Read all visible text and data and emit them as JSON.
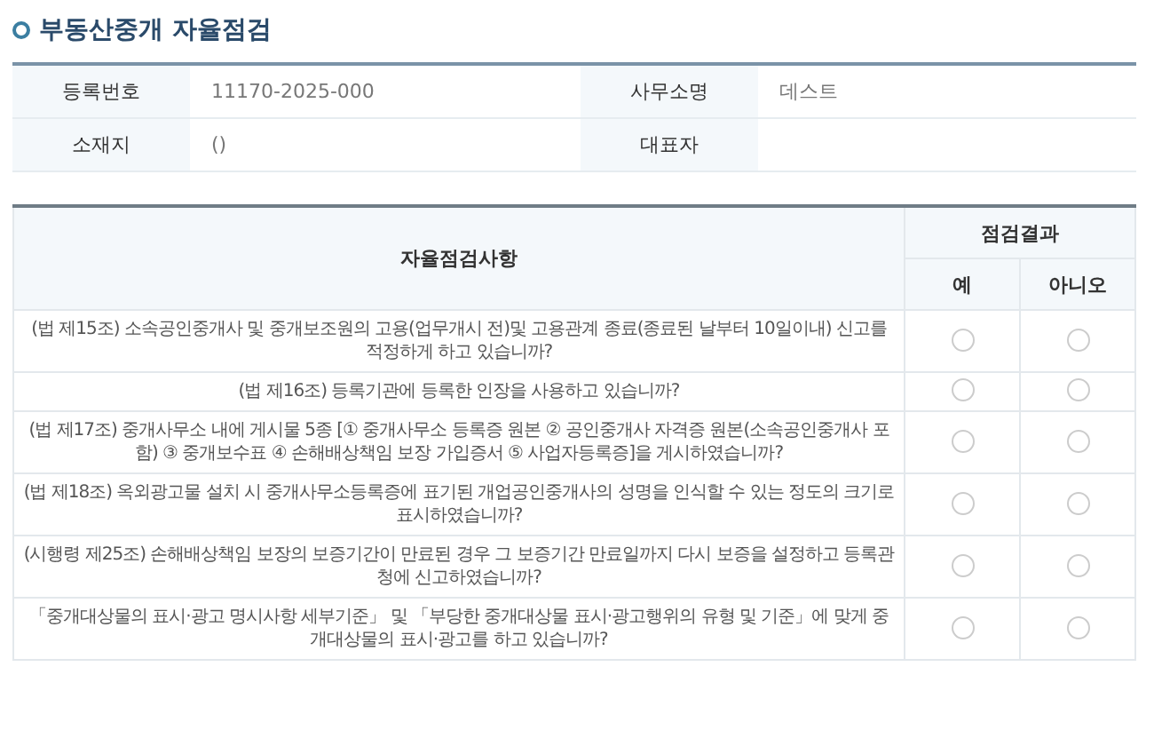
{
  "title": "부동산중개 자율점검",
  "info": [
    {
      "label": "등록번호",
      "value": "11170-2025-000"
    },
    {
      "label": "사무소명",
      "value": "데스트"
    },
    {
      "label": "소재지",
      "value": "()"
    },
    {
      "label": "대표자"
    }
  ],
  "checklist": {
    "item_header": "자율점검사항",
    "result_header": "점검결과",
    "options": [
      "예",
      "아니오"
    ],
    "rows": [
      {
        "text": "(법 제15조) 소속공인중개사 및 중개보조원의 고용(업무개시 전)및 고용관계 종료(종료된 날부터 10일이내) 신고를 적정하게 하고 있습니까?",
        "answers": [
          {
            "selected": false
          },
          {
            "selected": false
          }
        ]
      },
      {
        "text": "(법 제16조) 등록기관에 등록한 인장을 사용하고 있습니까?",
        "answers": [
          {
            "selected": false
          },
          {
            "selected": false
          }
        ]
      },
      {
        "text": "(법 제17조) 중개사무소 내에 게시물 5종 [① 중개사무소 등록증 원본 ② 공인중개사 자격증 원본(소속공인중개사 포함) ③ 중개보수표 ④ 손해배상책임 보장 가입증서 ⑤ 사업자등록증]을 게시하였습니까?",
        "answers": [
          {
            "selected": false
          },
          {
            "selected": false
          }
        ]
      },
      {
        "text": "(법 제18조) 옥외광고물 설치 시 중개사무소등록증에 표기된 개업공인중개사의 성명을 인식할 수 있는 정도의 크기로 표시하였습니까?",
        "answers": [
          {
            "selected": false
          },
          {
            "selected": false
          }
        ]
      },
      {
        "text": "(시행령 제25조) 손해배상책임 보장의 보증기간이 만료된 경우 그 보증기간 만료일까지 다시 보증을 설정하고 등록관청에 신고하였습니까?",
        "answers": [
          {
            "selected": false
          },
          {
            "selected": false
          }
        ]
      },
      {
        "text": "「중개대상물의 표시·광고 명시사항 세부기준」 및 「부당한 중개대상물 표시·광고행위의 유형 및 기준」에 맞게 중개대상물의 표시·광고를 하고 있습니까?",
        "answers": [
          {
            "selected": false
          },
          {
            "selected": false
          }
        ]
      }
    ]
  }
}
